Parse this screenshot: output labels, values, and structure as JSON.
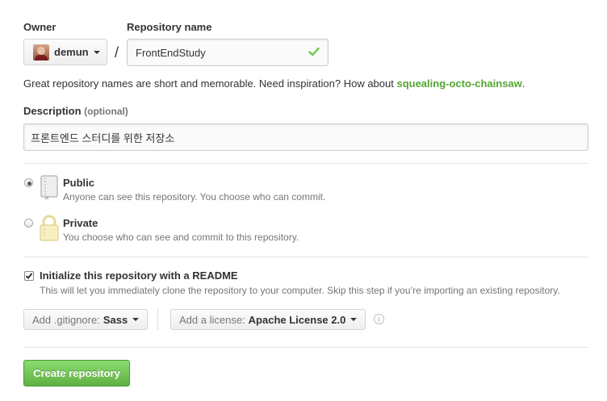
{
  "owner": {
    "label": "Owner",
    "value": "demun"
  },
  "repo": {
    "label": "Repository name",
    "value": "FrontEndStudy",
    "separator": "/"
  },
  "hint": {
    "text": "Great repository names are short and memorable. Need inspiration? How about ",
    "suggestion": "squealing-octo-chainsaw",
    "period": "."
  },
  "description": {
    "label": "Description",
    "optional": "(optional)",
    "value": "프론트엔드 스터디를 위한 저장소"
  },
  "visibility": {
    "public": {
      "title": "Public",
      "sub": "Anyone can see this repository. You choose who can commit.",
      "selected": true
    },
    "private": {
      "title": "Private",
      "sub": "You choose who can see and commit to this repository.",
      "selected": false
    }
  },
  "init": {
    "title": "Initialize this repository with a README",
    "sub": "This will let you immediately clone the repository to your computer. Skip this step if you’re importing an existing repository.",
    "checked": true
  },
  "gitignore": {
    "prefix": "Add .gitignore:",
    "value": "Sass"
  },
  "license": {
    "prefix": "Add a license:",
    "value": "Apache License 2.0"
  },
  "info_icon": "i",
  "create_button": "Create repository",
  "colors": {
    "success": "#6cc644",
    "suggestion": "#55a532",
    "button": "#60b044"
  }
}
